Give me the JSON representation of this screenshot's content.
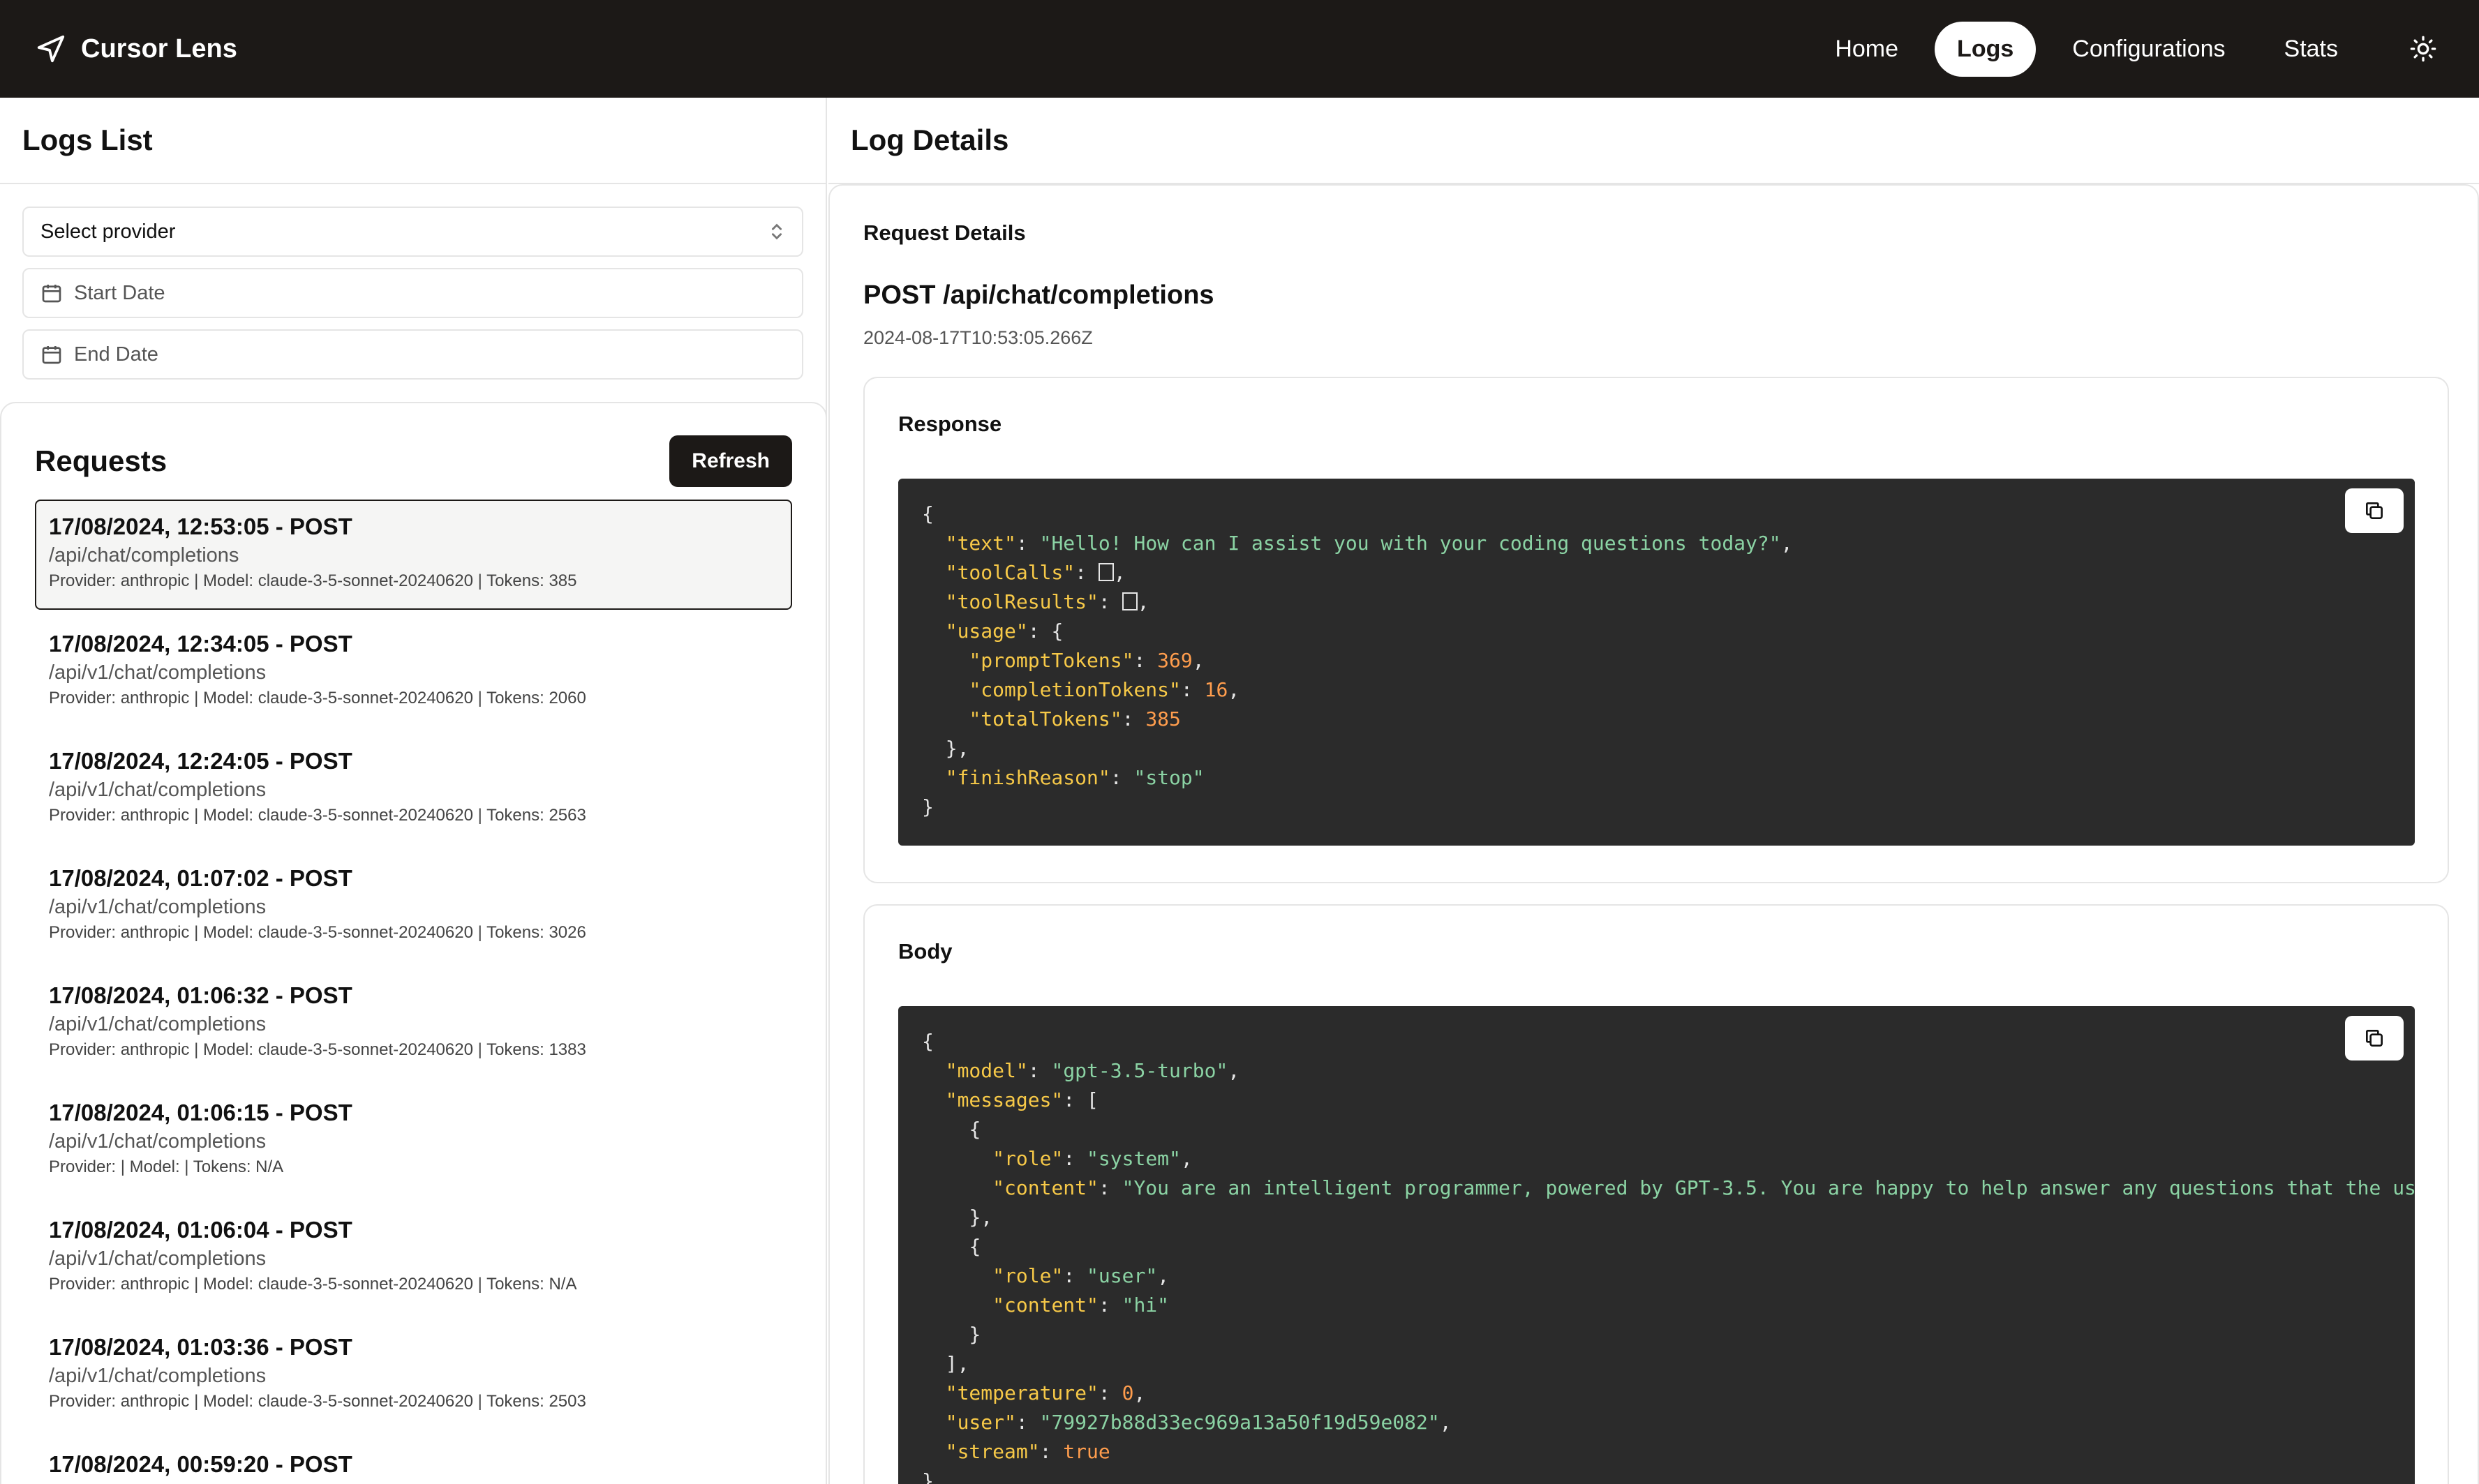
{
  "brand": {
    "title": "Cursor Lens"
  },
  "nav": {
    "items": [
      {
        "label": "Home",
        "active": false
      },
      {
        "label": "Logs",
        "active": true
      },
      {
        "label": "Configurations",
        "active": false
      },
      {
        "label": "Stats",
        "active": false
      }
    ]
  },
  "logs_list": {
    "title": "Logs List",
    "provider_select": "Select provider",
    "start_date": "Start Date",
    "end_date": "End Date",
    "requests_title": "Requests",
    "refresh_label": "Refresh",
    "requests": [
      {
        "title": "17/08/2024, 12:53:05 - POST",
        "path": "/api/chat/completions",
        "meta": "Provider: anthropic | Model: claude-3-5-sonnet-20240620 | Tokens: 385",
        "selected": true
      },
      {
        "title": "17/08/2024, 12:34:05 - POST",
        "path": "/api/v1/chat/completions",
        "meta": "Provider: anthropic | Model: claude-3-5-sonnet-20240620 | Tokens: 2060",
        "selected": false
      },
      {
        "title": "17/08/2024, 12:24:05 - POST",
        "path": "/api/v1/chat/completions",
        "meta": "Provider: anthropic | Model: claude-3-5-sonnet-20240620 | Tokens: 2563",
        "selected": false
      },
      {
        "title": "17/08/2024, 01:07:02 - POST",
        "path": "/api/v1/chat/completions",
        "meta": "Provider: anthropic | Model: claude-3-5-sonnet-20240620 | Tokens: 3026",
        "selected": false
      },
      {
        "title": "17/08/2024, 01:06:32 - POST",
        "path": "/api/v1/chat/completions",
        "meta": "Provider: anthropic | Model: claude-3-5-sonnet-20240620 | Tokens: 1383",
        "selected": false
      },
      {
        "title": "17/08/2024, 01:06:15 - POST",
        "path": "/api/v1/chat/completions",
        "meta": "Provider: | Model: | Tokens: N/A",
        "selected": false
      },
      {
        "title": "17/08/2024, 01:06:04 - POST",
        "path": "/api/v1/chat/completions",
        "meta": "Provider: anthropic | Model: claude-3-5-sonnet-20240620 | Tokens: N/A",
        "selected": false
      },
      {
        "title": "17/08/2024, 01:03:36 - POST",
        "path": "/api/v1/chat/completions",
        "meta": "Provider: anthropic | Model: claude-3-5-sonnet-20240620 | Tokens: 2503",
        "selected": false
      },
      {
        "title": "17/08/2024, 00:59:20 - POST",
        "path": "",
        "meta": "",
        "selected": false
      }
    ]
  },
  "log_details": {
    "title": "Log Details",
    "request_details_label": "Request Details",
    "heading": "POST /api/chat/completions",
    "timestamp": "2024-08-17T10:53:05.266Z",
    "response": {
      "title": "Response",
      "text": "Hello! How can I assist you with your coding questions today?",
      "prompt_tokens": "369",
      "completion_tokens": "16",
      "total_tokens": "385",
      "finish_reason": "stop"
    },
    "body": {
      "title": "Body",
      "model": "gpt-3.5-turbo",
      "system_role": "system",
      "system_content": "You are an intelligent programmer, powered by GPT-3.5. You are happy to help answer any questions that the use",
      "user_role": "user",
      "user_content": "hi",
      "temperature": "0",
      "user": "79927b88d33ec969a13a50f19d59e082",
      "stream": "true"
    }
  },
  "colors": {
    "navbar": "#1c1917",
    "code_bg": "#2b2b2b",
    "json_key": "#f7c948",
    "json_string": "#8bd3a4",
    "json_number": "#ff9d4d"
  }
}
